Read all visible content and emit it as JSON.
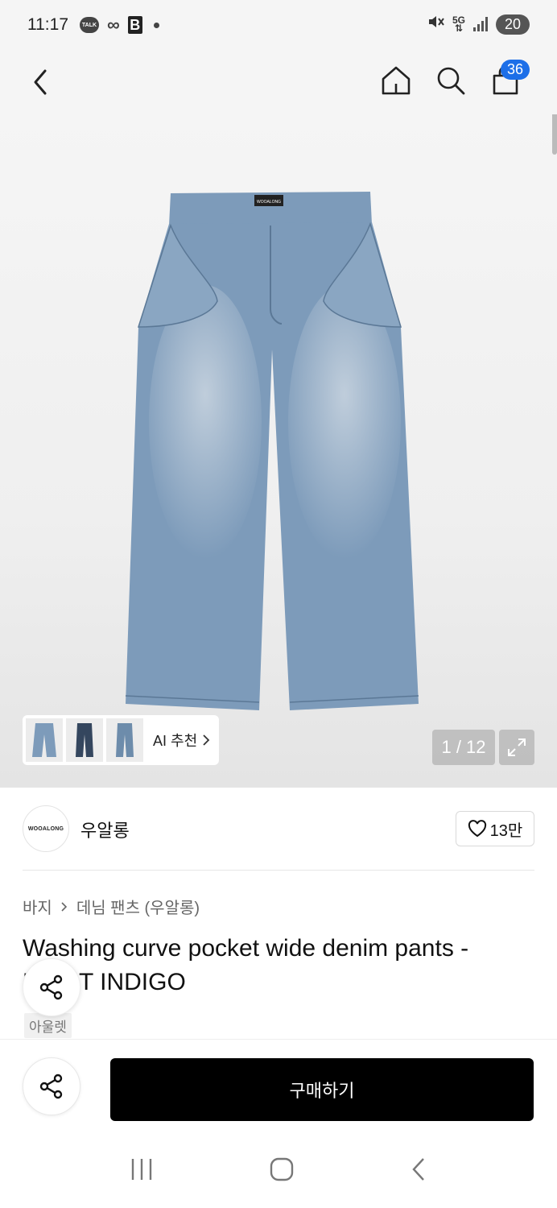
{
  "status_bar": {
    "time": "11:17",
    "talk_label": "TALK",
    "network": "5G",
    "battery": "20"
  },
  "nav": {
    "cart_count": "36"
  },
  "gallery": {
    "ai_label": "AI 추천",
    "pager": "1 / 12",
    "product_label": "WOOALONG"
  },
  "brand": {
    "logo_text": "WOOALONG",
    "name": "우알롱",
    "likes": "13만"
  },
  "breadcrumb": {
    "category": "바지",
    "subcategory": "데님 팬츠 (우알롱)"
  },
  "product": {
    "title": "Washing curve pocket wide denim pants - LIGHT INDIGO",
    "tag": "아울렛"
  },
  "actions": {
    "buy_label": "구매하기"
  },
  "colors": {
    "accent_badge": "#1d6fe8",
    "denim": "#7d9bba",
    "buy_button": "#000000"
  }
}
